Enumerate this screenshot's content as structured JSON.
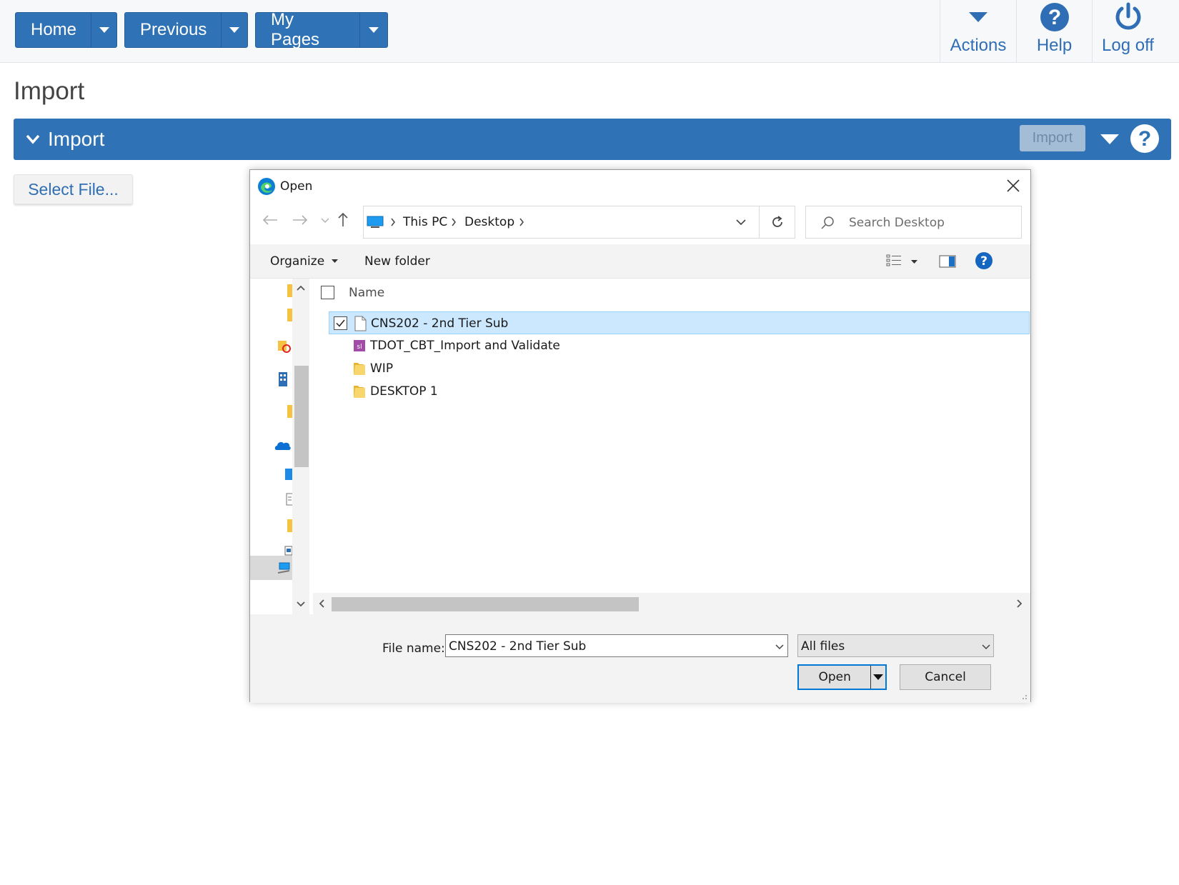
{
  "topnav": {
    "home": "Home",
    "previous": "Previous",
    "my_pages": "My Pages",
    "actions": "Actions",
    "help": "Help",
    "logoff": "Log off"
  },
  "page": {
    "title": "Import",
    "panel_title": "Import",
    "panel_import_button": "Import",
    "select_file": "Select File..."
  },
  "dialog": {
    "title": "Open",
    "breadcrumb": [
      "This PC",
      "Desktop"
    ],
    "search_placeholder": "Search Desktop",
    "toolbar": {
      "organize": "Organize",
      "new_folder": "New folder"
    },
    "column_name": "Name",
    "files": [
      {
        "name": "CNS202 - 2nd Tier Sub",
        "icon": "document-icon",
        "selected": true
      },
      {
        "name": "TDOT_CBT_Import and Validate",
        "icon": "sl-file-icon",
        "selected": false
      },
      {
        "name": "WIP",
        "icon": "folder-icon",
        "selected": false
      },
      {
        "name": "DESKTOP 1",
        "icon": "folder-icon",
        "selected": false
      }
    ],
    "file_name_label": "File name:",
    "file_name_value": "CNS202 - 2nd Tier Sub",
    "file_type": "All files",
    "open_button": "Open",
    "cancel_button": "Cancel"
  },
  "colors": {
    "brand_blue": "#2f72b6",
    "link_blue": "#2f6eb5",
    "selection": "#cce8ff",
    "accent": "#0078d7"
  }
}
